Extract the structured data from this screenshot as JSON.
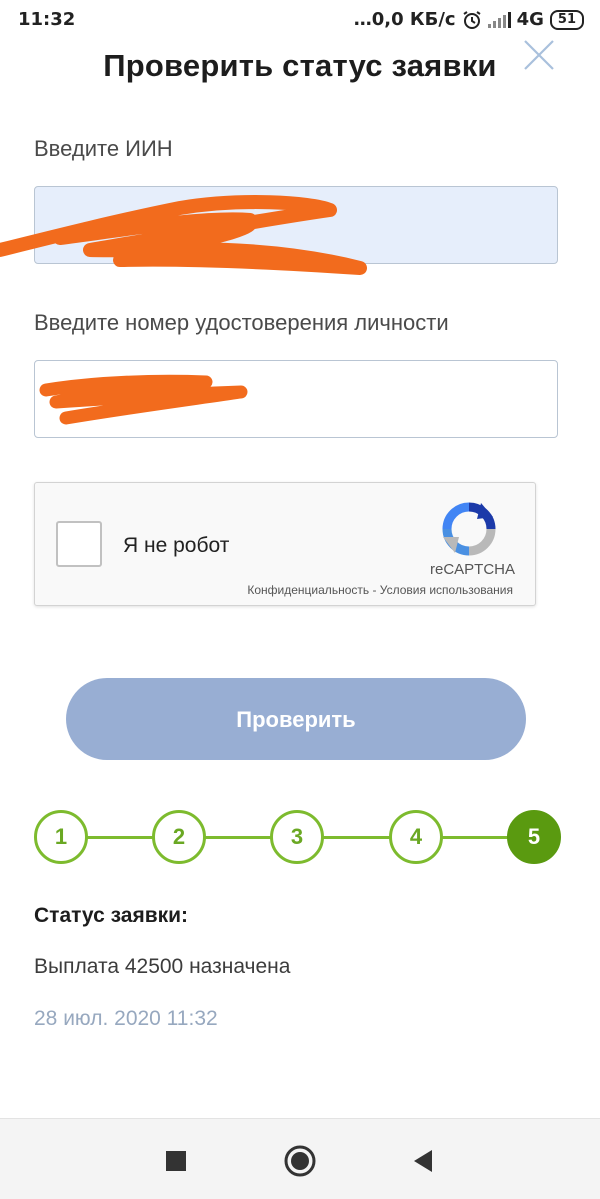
{
  "status_bar": {
    "time": "11:32",
    "network_speed": "…0,0 КБ/с",
    "network_type": "4G",
    "battery": "51",
    "icons": [
      "alarm-icon",
      "signal-icon",
      "battery-icon"
    ]
  },
  "dialog": {
    "title": "Проверить статус заявки",
    "close_icon": "close-icon"
  },
  "form": {
    "iin_label": "Введите ИИН",
    "iin_value": "",
    "id_label": "Введите номер удостоверения личности",
    "id_value": ""
  },
  "recaptcha": {
    "label": "Я не робот",
    "brand": "reCAPTCHA",
    "privacy": "Конфиденциальность",
    "separator": " - ",
    "terms": "Условия использования"
  },
  "submit_label": "Проверить",
  "steps": {
    "items": [
      "1",
      "2",
      "3",
      "4",
      "5"
    ],
    "active": "5"
  },
  "result": {
    "title": "Статус заявки:",
    "text": "Выплата 42500 назначена",
    "date": "28 июл. 2020 11:32"
  },
  "colors": {
    "accent_green": "#7dbb2e",
    "active_step": "#5a9a10",
    "button": "#98aed3",
    "redaction": "#f26b1d"
  },
  "nav": {
    "icons": [
      "recents-icon",
      "home-icon",
      "back-icon"
    ]
  }
}
